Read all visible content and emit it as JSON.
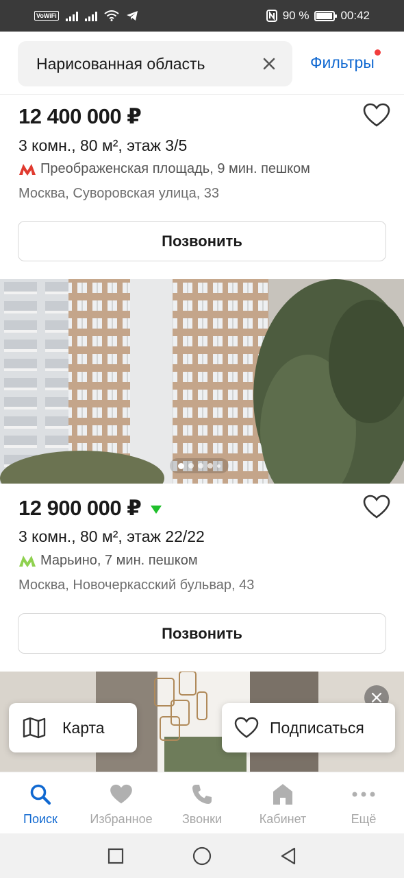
{
  "status_bar": {
    "network_badge": "VoWiFi",
    "battery_text": "90 %",
    "time": "00:42"
  },
  "search": {
    "query": "Нарисованная область",
    "filters_label": "Фильтры"
  },
  "listings": [
    {
      "price": "12 400 000 ₽",
      "details": "3 комн., 80 м², этаж 3/5",
      "metro": "Преображенская площадь, 9 мин. пешком",
      "metro_color": "#e03a2f",
      "address": "Москва, Суворовская улица, 33",
      "call_label": "Позвонить"
    },
    {
      "price": "12 900 000 ₽",
      "price_trend": "down",
      "details": "3 комн., 80 м², этаж 22/22",
      "metro": "Марьино, 7 мин. пешком",
      "metro_color": "#8fd14f",
      "address": "Москва, Новочеркасский бульвар, 43",
      "call_label": "Позвонить",
      "photo_count": 5,
      "photo_active_index": 0
    }
  ],
  "floating": {
    "map_label": "Карта",
    "subscribe_label": "Подписаться"
  },
  "bottom_nav": [
    {
      "label": "Поиск",
      "icon": "search-icon",
      "active": true
    },
    {
      "label": "Избранное",
      "icon": "heart-icon",
      "active": false
    },
    {
      "label": "Звонки",
      "icon": "phone-icon",
      "active": false
    },
    {
      "label": "Кабинет",
      "icon": "home-icon",
      "active": false
    },
    {
      "label": "Ещё",
      "icon": "more-icon",
      "active": false
    }
  ],
  "colors": {
    "accent": "#1169d1",
    "price_down": "#1fbf2b",
    "notification_dot": "#f23d3d"
  }
}
